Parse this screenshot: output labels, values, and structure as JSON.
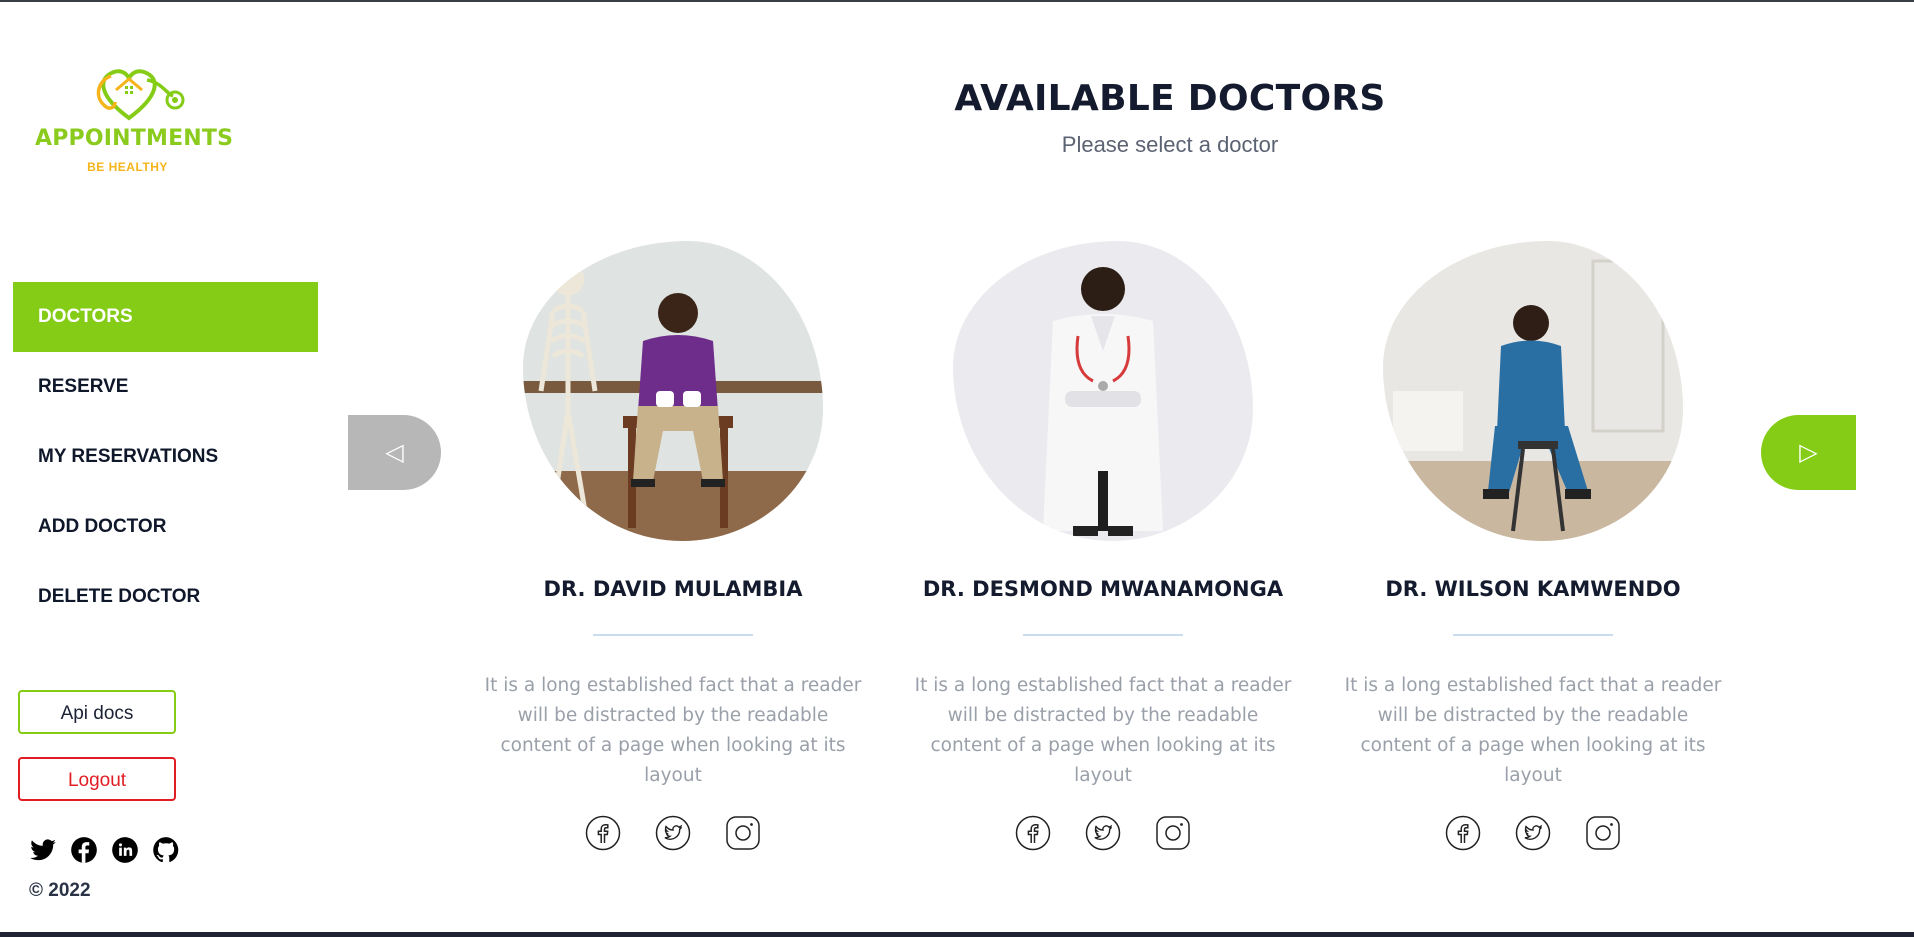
{
  "brand": {
    "title": "APPOINTMENTS",
    "tagline": "BE HEALTHY",
    "primary_color": "#85cc17",
    "accent_color": "#f4b41a"
  },
  "nav": {
    "items": [
      {
        "label": "DOCTORS",
        "active": true
      },
      {
        "label": "RESERVE"
      },
      {
        "label": "MY RESERVATIONS"
      },
      {
        "label": "ADD DOCTOR"
      },
      {
        "label": "DELETE DOCTOR"
      }
    ]
  },
  "buttons": {
    "api_docs": "Api docs",
    "logout": "Logout"
  },
  "sidebar_social": [
    "twitter-icon",
    "facebook-icon",
    "linkedin-icon",
    "github-icon"
  ],
  "copyright": "© 2022",
  "header": {
    "title": "AVAILABLE DOCTORS",
    "subtitle": "Please select a doctor"
  },
  "carousel": {
    "prev_icon": "◁",
    "next_icon": "▷"
  },
  "doctors": [
    {
      "name": "DR. DAVID MULAMBIA",
      "description": "It is a long established fact that a reader will be distracted by the readable content of a page when looking at its layout"
    },
    {
      "name": "DR. DESMOND MWANAMONGA",
      "description": "It is a long established fact that a reader will be distracted by the readable content of a page when looking at its layout"
    },
    {
      "name": "DR. WILSON KAMWENDO",
      "description": "It is a long established fact that a reader will be distracted by the readable content of a page when looking at its layout"
    }
  ],
  "card_social": [
    "facebook-icon",
    "twitter-icon",
    "instagram-icon"
  ]
}
